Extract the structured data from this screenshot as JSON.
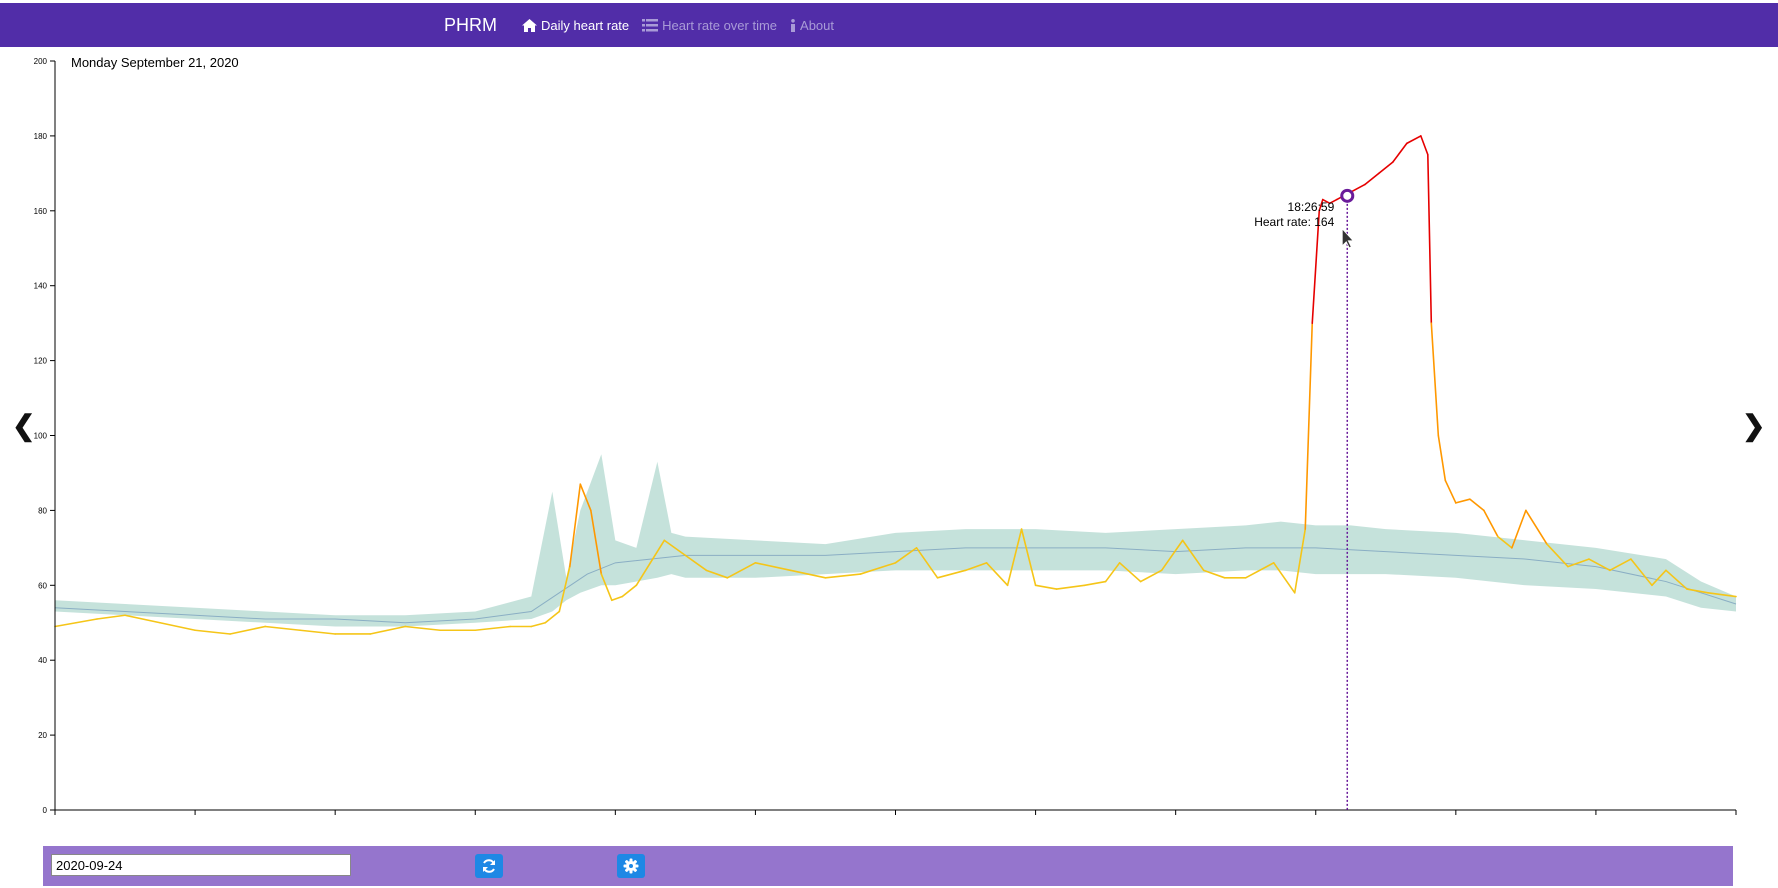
{
  "nav": {
    "brand": "PHRM",
    "items": [
      {
        "label": "Daily heart rate",
        "icon": "home-icon",
        "active": true
      },
      {
        "label": "Heart rate over time",
        "icon": "list-icon",
        "active": false
      },
      {
        "label": "About",
        "icon": "info-icon",
        "active": false
      }
    ]
  },
  "navigation": {
    "prev_label": "❮",
    "next_label": "❯"
  },
  "controls": {
    "date_value": "2020-09-24",
    "refresh_icon": "refresh-icon",
    "settings_icon": "gear-icon"
  },
  "colors": {
    "nav_bg": "#512da8",
    "bottom_bar_bg": "#9575cd",
    "button_bg": "#1e88e5",
    "band_fill": "#b2d8cf",
    "median_line": "#8aaec4",
    "low_hr": "#f5c518",
    "mid_hr": "#ff9800",
    "high_hr": "#e60000",
    "cursor": "#6a1b9a"
  },
  "chart_data": {
    "type": "line",
    "title": "Monday September 21, 2020",
    "xlabel": "",
    "ylabel": "",
    "xlim": [
      0,
      24
    ],
    "ylim": [
      0,
      200
    ],
    "x_ticks": [
      0,
      2,
      4,
      6,
      8,
      10,
      12,
      14,
      16,
      18,
      20,
      22,
      24
    ],
    "y_ticks": [
      0,
      20,
      40,
      60,
      80,
      100,
      120,
      140,
      160,
      180,
      200
    ],
    "grid": false,
    "series": [
      {
        "kind": "band",
        "x": [
          0,
          1,
          2,
          3,
          4,
          5,
          6,
          6.8,
          7.1,
          7.3,
          7.5,
          7.8,
          8,
          8.3,
          8.6,
          8.8,
          9,
          10,
          11,
          12,
          13,
          14,
          15,
          16,
          17,
          17.5,
          18,
          18.5,
          19,
          20,
          21,
          22,
          23,
          23.5,
          24
        ],
        "upper": [
          56,
          55,
          54,
          53,
          52,
          52,
          53,
          57,
          85,
          62,
          80,
          95,
          72,
          70,
          93,
          74,
          73,
          72,
          71,
          74,
          75,
          75,
          74,
          75,
          76,
          77,
          76,
          76,
          75,
          74,
          72,
          70,
          67,
          61,
          57
        ],
        "lower": [
          53,
          52,
          51,
          50,
          49,
          49,
          50,
          51,
          53,
          56,
          58,
          60,
          60,
          61,
          62,
          63,
          62,
          62,
          63,
          64,
          64,
          64,
          64,
          63,
          64,
          64,
          63,
          63,
          63,
          62,
          60,
          59,
          57,
          54,
          53
        ]
      },
      {
        "kind": "median",
        "x": [
          0,
          1,
          2,
          3,
          4,
          5,
          6,
          6.8,
          7.2,
          7.6,
          8,
          8.5,
          9,
          10,
          11,
          12,
          13,
          14,
          15,
          16,
          17,
          18,
          19,
          20,
          21,
          22,
          23,
          24
        ],
        "y": [
          54,
          53,
          52,
          51,
          51,
          50,
          51,
          53,
          58,
          63,
          66,
          67,
          68,
          68,
          68,
          69,
          70,
          70,
          70,
          69,
          70,
          70,
          69,
          68,
          67,
          65,
          61,
          55
        ]
      },
      {
        "kind": "heart-rate",
        "x": [
          0,
          0.3,
          0.6,
          1,
          1.5,
          2,
          2.5,
          3,
          3.5,
          4,
          4.5,
          5,
          5.5,
          6,
          6.5,
          6.8,
          7,
          7.2,
          7.35,
          7.5,
          7.65,
          7.8,
          7.95,
          8.1,
          8.3,
          8.5,
          8.7,
          9,
          9.3,
          9.6,
          10,
          10.5,
          11,
          11.5,
          12,
          12.3,
          12.6,
          13,
          13.3,
          13.6,
          13.8,
          14,
          14.3,
          14.7,
          15,
          15.2,
          15.5,
          15.8,
          16.1,
          16.4,
          16.7,
          17,
          17.4,
          17.7,
          17.85,
          17.95,
          18.05,
          18.1,
          18.2,
          18.3,
          18.4,
          18.5,
          18.7,
          18.9,
          19.1,
          19.3,
          19.5,
          19.6,
          19.65,
          19.75,
          19.85,
          20,
          20.2,
          20.4,
          20.6,
          20.8,
          21,
          21.3,
          21.6,
          21.9,
          22.2,
          22.5,
          22.8,
          23,
          23.3,
          23.6,
          24
        ],
        "y": [
          49,
          50,
          51,
          52,
          50,
          48,
          47,
          49,
          48,
          47,
          47,
          49,
          48,
          48,
          49,
          49,
          50,
          53,
          65,
          87,
          80,
          63,
          56,
          57,
          60,
          66,
          72,
          68,
          64,
          62,
          66,
          64,
          62,
          63,
          66,
          70,
          62,
          64,
          66,
          60,
          75,
          60,
          59,
          60,
          61,
          66,
          61,
          64,
          72,
          64,
          62,
          62,
          66,
          58,
          75,
          130,
          160,
          163,
          162,
          163,
          164,
          165,
          167,
          170,
          173,
          178,
          180,
          175,
          130,
          100,
          88,
          82,
          83,
          80,
          73,
          70,
          80,
          71,
          65,
          67,
          64,
          67,
          60,
          64,
          59,
          58,
          57
        ]
      }
    ],
    "y_thresholds": {
      "mid": 78,
      "high": 155
    },
    "cursor": {
      "time": "18:26:59",
      "label_time": "18:26:59",
      "label_rate": "Heart rate: 164",
      "x": 18.45,
      "y": 164
    }
  }
}
